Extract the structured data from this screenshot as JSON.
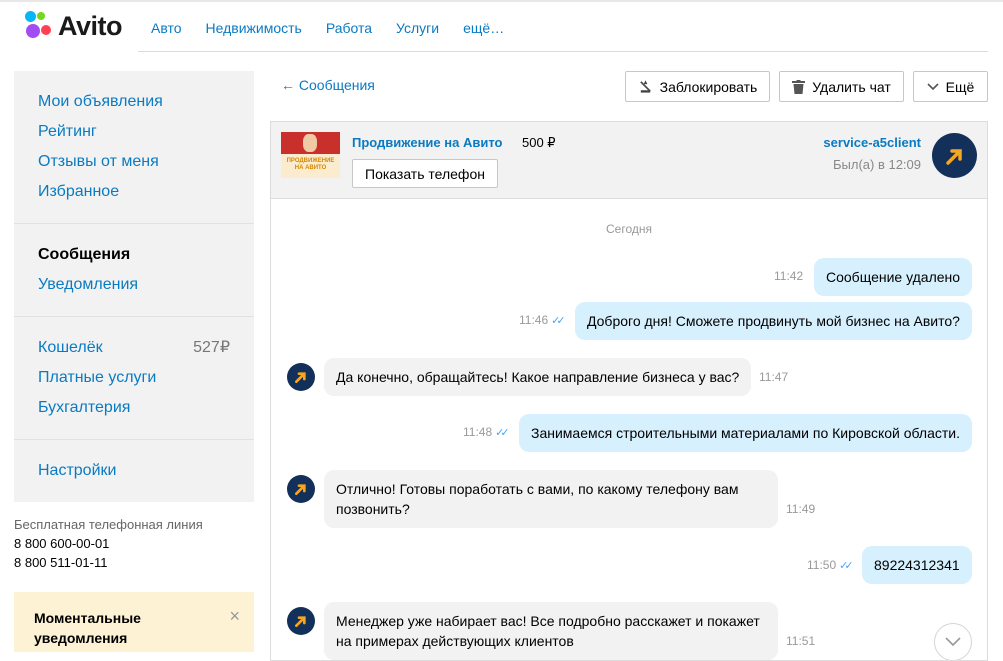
{
  "header": {
    "logo": "Avito",
    "nav": [
      "Авто",
      "Недвижимость",
      "Работа",
      "Услуги",
      "ещё…"
    ]
  },
  "sidebar": {
    "group1": [
      "Мои объявления",
      "Рейтинг",
      "Отзывы от меня",
      "Избранное"
    ],
    "group2": [
      "Сообщения",
      "Уведомления"
    ],
    "group3": {
      "wallet": "Кошелёк",
      "wallet_amount": "527₽",
      "paid": "Платные услуги",
      "accounting": "Бухгалтерия"
    },
    "group4": [
      "Настройки"
    ],
    "phone_caption": "Бесплатная телефонная линия",
    "phones": [
      "8 800 600-00-01",
      "8 800 511-01-11"
    ],
    "notify_title": "Моментальные уведомления",
    "notify_close": "×"
  },
  "toolbar": {
    "back": "← Сообщения",
    "block": "Заблокировать",
    "delete": "Удалить чат",
    "more": "Ещё"
  },
  "chat_head": {
    "thumb_caption": "ПРОДВИЖЕНИЕ НА АВИТО",
    "ad_title": "Продвижение на Авито",
    "ad_price": "500 ₽",
    "show_phone": "Показать телефон",
    "user_name": "service-a5client",
    "last_seen": "Был(а) в 12:09"
  },
  "messages": {
    "day": "Сегодня",
    "m1": {
      "time": "11:42",
      "text": "Сообщение удалено"
    },
    "m2": {
      "time": "11:46",
      "text": "Доброго дня! Сможете продвинуть мой бизнес на Авито?"
    },
    "m3": {
      "time": "11:47",
      "text": "Да конечно, обращайтесь! Какое направление бизнеса у вас?"
    },
    "m4": {
      "time": "11:48",
      "text": "Занимаемся строительными материалами по Кировской области."
    },
    "m5": {
      "time": "11:49",
      "text": "Отлично! Готовы поработать с вами, по какому телефону вам позвонить?"
    },
    "m6": {
      "time": "11:50",
      "text": "89224312341"
    },
    "m7": {
      "time": "11:51",
      "text": "Менеджер уже набирает вас! Все подробно расскажет и покажет на примерах действующих клиентов"
    }
  }
}
